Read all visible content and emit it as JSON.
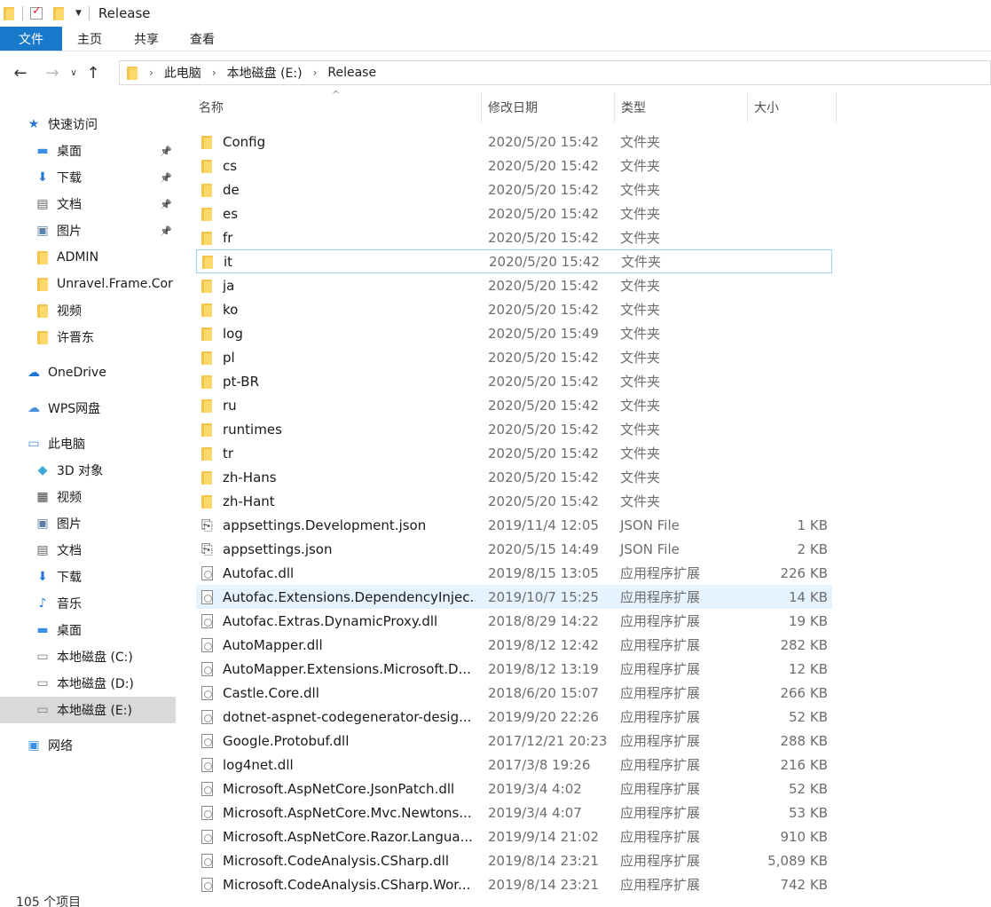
{
  "window": {
    "title": "Release"
  },
  "ribbon": {
    "tabs": [
      "文件",
      "主页",
      "共享",
      "查看"
    ]
  },
  "address": {
    "crumbs": [
      "此电脑",
      "本地磁盘 (E:)",
      "Release"
    ]
  },
  "nav": {
    "items": [
      {
        "label": "快速访问",
        "icon": "star-icon",
        "glyph": "★",
        "color": "#2b78d4",
        "pinned": false,
        "indent": 0
      },
      {
        "label": "桌面",
        "icon": "desktop-icon",
        "glyph": "▬",
        "color": "#3a8ee6",
        "pinned": true,
        "indent": 1
      },
      {
        "label": "下载",
        "icon": "download-icon",
        "glyph": "⬇",
        "color": "#2b78d4",
        "pinned": true,
        "indent": 1
      },
      {
        "label": "文档",
        "icon": "document-icon",
        "glyph": "▤",
        "color": "#666666",
        "pinned": true,
        "indent": 1
      },
      {
        "label": "图片",
        "icon": "pictures-icon",
        "glyph": "▣",
        "color": "#5b7fa6",
        "pinned": true,
        "indent": 1
      },
      {
        "label": "ADMIN",
        "icon": "folder-icon",
        "glyph": "",
        "color": "#f3c54d",
        "pinned": false,
        "indent": 1
      },
      {
        "label": "Unravel.Frame.Cor",
        "icon": "folder-icon",
        "glyph": "",
        "color": "#f3c54d",
        "pinned": false,
        "indent": 1
      },
      {
        "label": "视频",
        "icon": "folder-icon",
        "glyph": "",
        "color": "#f3c54d",
        "pinned": false,
        "indent": 1
      },
      {
        "label": "许晋东",
        "icon": "folder-icon",
        "glyph": "",
        "color": "#f3c54d",
        "pinned": false,
        "indent": 1
      },
      {
        "label": "OneDrive",
        "icon": "onedrive-icon",
        "glyph": "☁",
        "color": "#1e74d6",
        "pinned": false,
        "indent": 0
      },
      {
        "label": "WPS网盘",
        "icon": "wps-cloud-icon",
        "glyph": "☁",
        "color": "#4a8fe0",
        "pinned": false,
        "indent": 0
      },
      {
        "label": "此电脑",
        "icon": "this-pc-icon",
        "glyph": "▭",
        "color": "#4a8fe0",
        "pinned": false,
        "indent": 0
      },
      {
        "label": "3D 对象",
        "icon": "3d-objects-icon",
        "glyph": "◆",
        "color": "#39a9d9",
        "pinned": false,
        "indent": 1
      },
      {
        "label": "视频",
        "icon": "videos-icon",
        "glyph": "▦",
        "color": "#444444",
        "pinned": false,
        "indent": 1
      },
      {
        "label": "图片",
        "icon": "pictures-icon",
        "glyph": "▣",
        "color": "#5b7fa6",
        "pinned": false,
        "indent": 1
      },
      {
        "label": "文档",
        "icon": "document-icon",
        "glyph": "▤",
        "color": "#666666",
        "pinned": false,
        "indent": 1
      },
      {
        "label": "下载",
        "icon": "download-icon",
        "glyph": "⬇",
        "color": "#2b78d4",
        "pinned": false,
        "indent": 1
      },
      {
        "label": "音乐",
        "icon": "music-icon",
        "glyph": "♪",
        "color": "#2b78d4",
        "pinned": false,
        "indent": 1
      },
      {
        "label": "桌面",
        "icon": "desktop-icon",
        "glyph": "▬",
        "color": "#3a8ee6",
        "pinned": false,
        "indent": 1
      },
      {
        "label": "本地磁盘 (C:)",
        "icon": "drive-c-icon",
        "glyph": "▭",
        "color": "#777777",
        "pinned": false,
        "indent": 1
      },
      {
        "label": "本地磁盘 (D:)",
        "icon": "drive-icon",
        "glyph": "▭",
        "color": "#777777",
        "pinned": false,
        "indent": 1
      },
      {
        "label": "本地磁盘 (E:)",
        "icon": "drive-icon",
        "glyph": "▭",
        "color": "#777777",
        "pinned": false,
        "indent": 1,
        "selected": true
      },
      {
        "label": "网络",
        "icon": "network-icon",
        "glyph": "▣",
        "color": "#3a8ee6",
        "pinned": false,
        "indent": 0
      }
    ]
  },
  "columns": {
    "name": "名称",
    "date": "修改日期",
    "type": "类型",
    "size": "大小"
  },
  "files": [
    {
      "name": "Config",
      "date": "2020/5/20 15:42",
      "type": "文件夹",
      "size": "",
      "kind": "folder"
    },
    {
      "name": "cs",
      "date": "2020/5/20 15:42",
      "type": "文件夹",
      "size": "",
      "kind": "folder"
    },
    {
      "name": "de",
      "date": "2020/5/20 15:42",
      "type": "文件夹",
      "size": "",
      "kind": "folder"
    },
    {
      "name": "es",
      "date": "2020/5/20 15:42",
      "type": "文件夹",
      "size": "",
      "kind": "folder"
    },
    {
      "name": "fr",
      "date": "2020/5/20 15:42",
      "type": "文件夹",
      "size": "",
      "kind": "folder"
    },
    {
      "name": "it",
      "date": "2020/5/20 15:42",
      "type": "文件夹",
      "size": "",
      "kind": "folder",
      "state": "focus"
    },
    {
      "name": "ja",
      "date": "2020/5/20 15:42",
      "type": "文件夹",
      "size": "",
      "kind": "folder"
    },
    {
      "name": "ko",
      "date": "2020/5/20 15:42",
      "type": "文件夹",
      "size": "",
      "kind": "folder"
    },
    {
      "name": "log",
      "date": "2020/5/20 15:49",
      "type": "文件夹",
      "size": "",
      "kind": "folder"
    },
    {
      "name": "pl",
      "date": "2020/5/20 15:42",
      "type": "文件夹",
      "size": "",
      "kind": "folder"
    },
    {
      "name": "pt-BR",
      "date": "2020/5/20 15:42",
      "type": "文件夹",
      "size": "",
      "kind": "folder"
    },
    {
      "name": "ru",
      "date": "2020/5/20 15:42",
      "type": "文件夹",
      "size": "",
      "kind": "folder"
    },
    {
      "name": "runtimes",
      "date": "2020/5/20 15:42",
      "type": "文件夹",
      "size": "",
      "kind": "folder"
    },
    {
      "name": "tr",
      "date": "2020/5/20 15:42",
      "type": "文件夹",
      "size": "",
      "kind": "folder"
    },
    {
      "name": "zh-Hans",
      "date": "2020/5/20 15:42",
      "type": "文件夹",
      "size": "",
      "kind": "folder"
    },
    {
      "name": "zh-Hant",
      "date": "2020/5/20 15:42",
      "type": "文件夹",
      "size": "",
      "kind": "folder"
    },
    {
      "name": "appsettings.Development.json",
      "date": "2019/11/4 12:05",
      "type": "JSON File",
      "size": "1 KB",
      "kind": "json"
    },
    {
      "name": "appsettings.json",
      "date": "2020/5/15 14:49",
      "type": "JSON File",
      "size": "2 KB",
      "kind": "json"
    },
    {
      "name": "Autofac.dll",
      "date": "2019/8/15 13:05",
      "type": "应用程序扩展",
      "size": "226 KB",
      "kind": "dll"
    },
    {
      "name": "Autofac.Extensions.DependencyInjec...",
      "date": "2019/10/7 15:25",
      "type": "应用程序扩展",
      "size": "14 KB",
      "kind": "dll",
      "state": "hover"
    },
    {
      "name": "Autofac.Extras.DynamicProxy.dll",
      "date": "2018/8/29 14:22",
      "type": "应用程序扩展",
      "size": "19 KB",
      "kind": "dll"
    },
    {
      "name": "AutoMapper.dll",
      "date": "2019/8/12 12:42",
      "type": "应用程序扩展",
      "size": "282 KB",
      "kind": "dll"
    },
    {
      "name": "AutoMapper.Extensions.Microsoft.D...",
      "date": "2019/8/12 13:19",
      "type": "应用程序扩展",
      "size": "12 KB",
      "kind": "dll"
    },
    {
      "name": "Castle.Core.dll",
      "date": "2018/6/20 15:07",
      "type": "应用程序扩展",
      "size": "266 KB",
      "kind": "dll"
    },
    {
      "name": "dotnet-aspnet-codegenerator-desig...",
      "date": "2019/9/20 22:26",
      "type": "应用程序扩展",
      "size": "52 KB",
      "kind": "dll"
    },
    {
      "name": "Google.Protobuf.dll",
      "date": "2017/12/21 20:23",
      "type": "应用程序扩展",
      "size": "288 KB",
      "kind": "dll"
    },
    {
      "name": "log4net.dll",
      "date": "2017/3/8 19:26",
      "type": "应用程序扩展",
      "size": "216 KB",
      "kind": "dll"
    },
    {
      "name": "Microsoft.AspNetCore.JsonPatch.dll",
      "date": "2019/3/4 4:02",
      "type": "应用程序扩展",
      "size": "52 KB",
      "kind": "dll"
    },
    {
      "name": "Microsoft.AspNetCore.Mvc.Newtons...",
      "date": "2019/3/4 4:07",
      "type": "应用程序扩展",
      "size": "53 KB",
      "kind": "dll"
    },
    {
      "name": "Microsoft.AspNetCore.Razor.Langua...",
      "date": "2019/9/14 21:02",
      "type": "应用程序扩展",
      "size": "910 KB",
      "kind": "dll"
    },
    {
      "name": "Microsoft.CodeAnalysis.CSharp.dll",
      "date": "2019/8/14 23:21",
      "type": "应用程序扩展",
      "size": "5,089 KB",
      "kind": "dll"
    },
    {
      "name": "Microsoft.CodeAnalysis.CSharp.Wor...",
      "date": "2019/8/14 23:21",
      "type": "应用程序扩展",
      "size": "742 KB",
      "kind": "dll"
    }
  ],
  "status": {
    "count": "105 个项目"
  }
}
